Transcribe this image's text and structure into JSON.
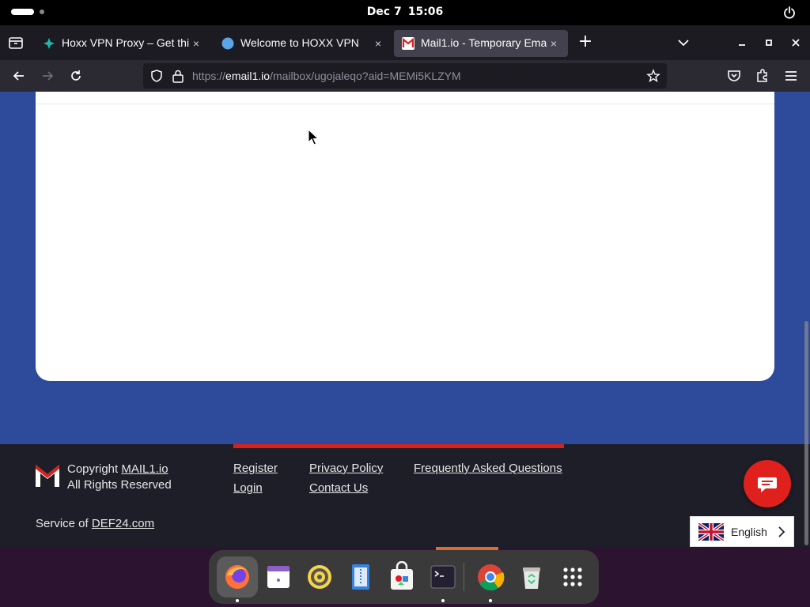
{
  "system": {
    "date": "Dec 7",
    "time": "15:06"
  },
  "browser": {
    "tabs": [
      {
        "title": "Hoxx VPN Proxy – Get thi",
        "icon": "hoxx-vpn-icon",
        "active": false
      },
      {
        "title": "Welcome to HOXX VPN",
        "icon": "globe-icon",
        "active": false
      },
      {
        "title": "Mail1.io - Temporary Ema",
        "icon": "mail1-icon",
        "active": true
      }
    ],
    "close_glyph": "×",
    "new_tab_glyph": "+",
    "url": {
      "scheme": "https://",
      "host": "email1.io",
      "path": "/mailbox/ugojaleqo?aid=MEMi5KLZYM"
    }
  },
  "footer": {
    "copyright_prefix": "Copyright ",
    "copyright_link": "MAIL1.io",
    "rights": "All Rights Reserved",
    "links": {
      "register": "Register",
      "login": "Login",
      "privacy": "Privacy Policy",
      "contact": "Contact Us",
      "faq": "Frequently Asked Questions"
    },
    "service_prefix": "Service of ",
    "service_link": "DEF24.com"
  },
  "language": {
    "label": "English",
    "flag": "uk-flag-icon"
  },
  "colors": {
    "page_bg": "#2d4a9b",
    "footer_bg": "#1e1e28",
    "accent_red": "#d8201c",
    "chat_button": "#e0201d"
  },
  "dock": {
    "apps": [
      "firefox-icon",
      "calendar-icon",
      "rhythmbox-icon",
      "text-editor-icon",
      "software-center-icon",
      "terminal-icon",
      "chrome-icon",
      "trash-icon",
      "app-grid-icon"
    ]
  }
}
